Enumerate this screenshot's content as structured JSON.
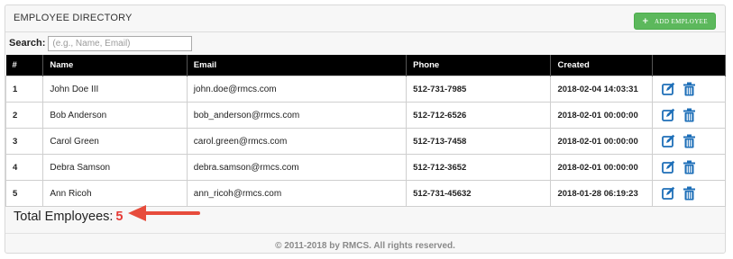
{
  "header": {
    "title": "EMPLOYEE DIRECTORY",
    "add_button_label": "ADD EMPLOYEE",
    "add_button_icon": "plus-icon"
  },
  "search": {
    "label": "Search:",
    "placeholder": "(e.g., Name, Email)",
    "value": ""
  },
  "table": {
    "columns": [
      "#",
      "Name",
      "Email",
      "Phone",
      "Created",
      ""
    ],
    "rows": [
      {
        "num": "1",
        "name": "John Doe III",
        "email": "john.doe@rmcs.com",
        "phone": "512-731-7985",
        "created": "2018-02-04 14:03:31"
      },
      {
        "num": "2",
        "name": "Bob Anderson",
        "email": "bob_anderson@rmcs.com",
        "phone": "512-712-6526",
        "created": "2018-02-01 00:00:00"
      },
      {
        "num": "3",
        "name": "Carol Green",
        "email": "carol.green@rmcs.com",
        "phone": "512-713-7458",
        "created": "2018-02-01 00:00:00"
      },
      {
        "num": "4",
        "name": "Debra Samson",
        "email": "debra.samson@rmcs.com",
        "phone": "512-712-3652",
        "created": "2018-02-01 00:00:00"
      },
      {
        "num": "5",
        "name": "Ann Ricoh",
        "email": "ann_ricoh@rmcs.com",
        "phone": "512-731-45632",
        "created": "2018-01-28 06:19:23"
      }
    ],
    "row_actions": [
      "edit-icon",
      "trash-icon"
    ]
  },
  "summary": {
    "label": "Total Employees:",
    "count": "5"
  },
  "footer": {
    "text": "© 2011-2018 by RMCS. All rights reserved."
  },
  "colors": {
    "accent_green": "#5cb85c",
    "header_black": "#000000",
    "icon_blue": "#1e6fb8",
    "count_red": "#e53935",
    "arrow_red": "#e74c3c"
  }
}
